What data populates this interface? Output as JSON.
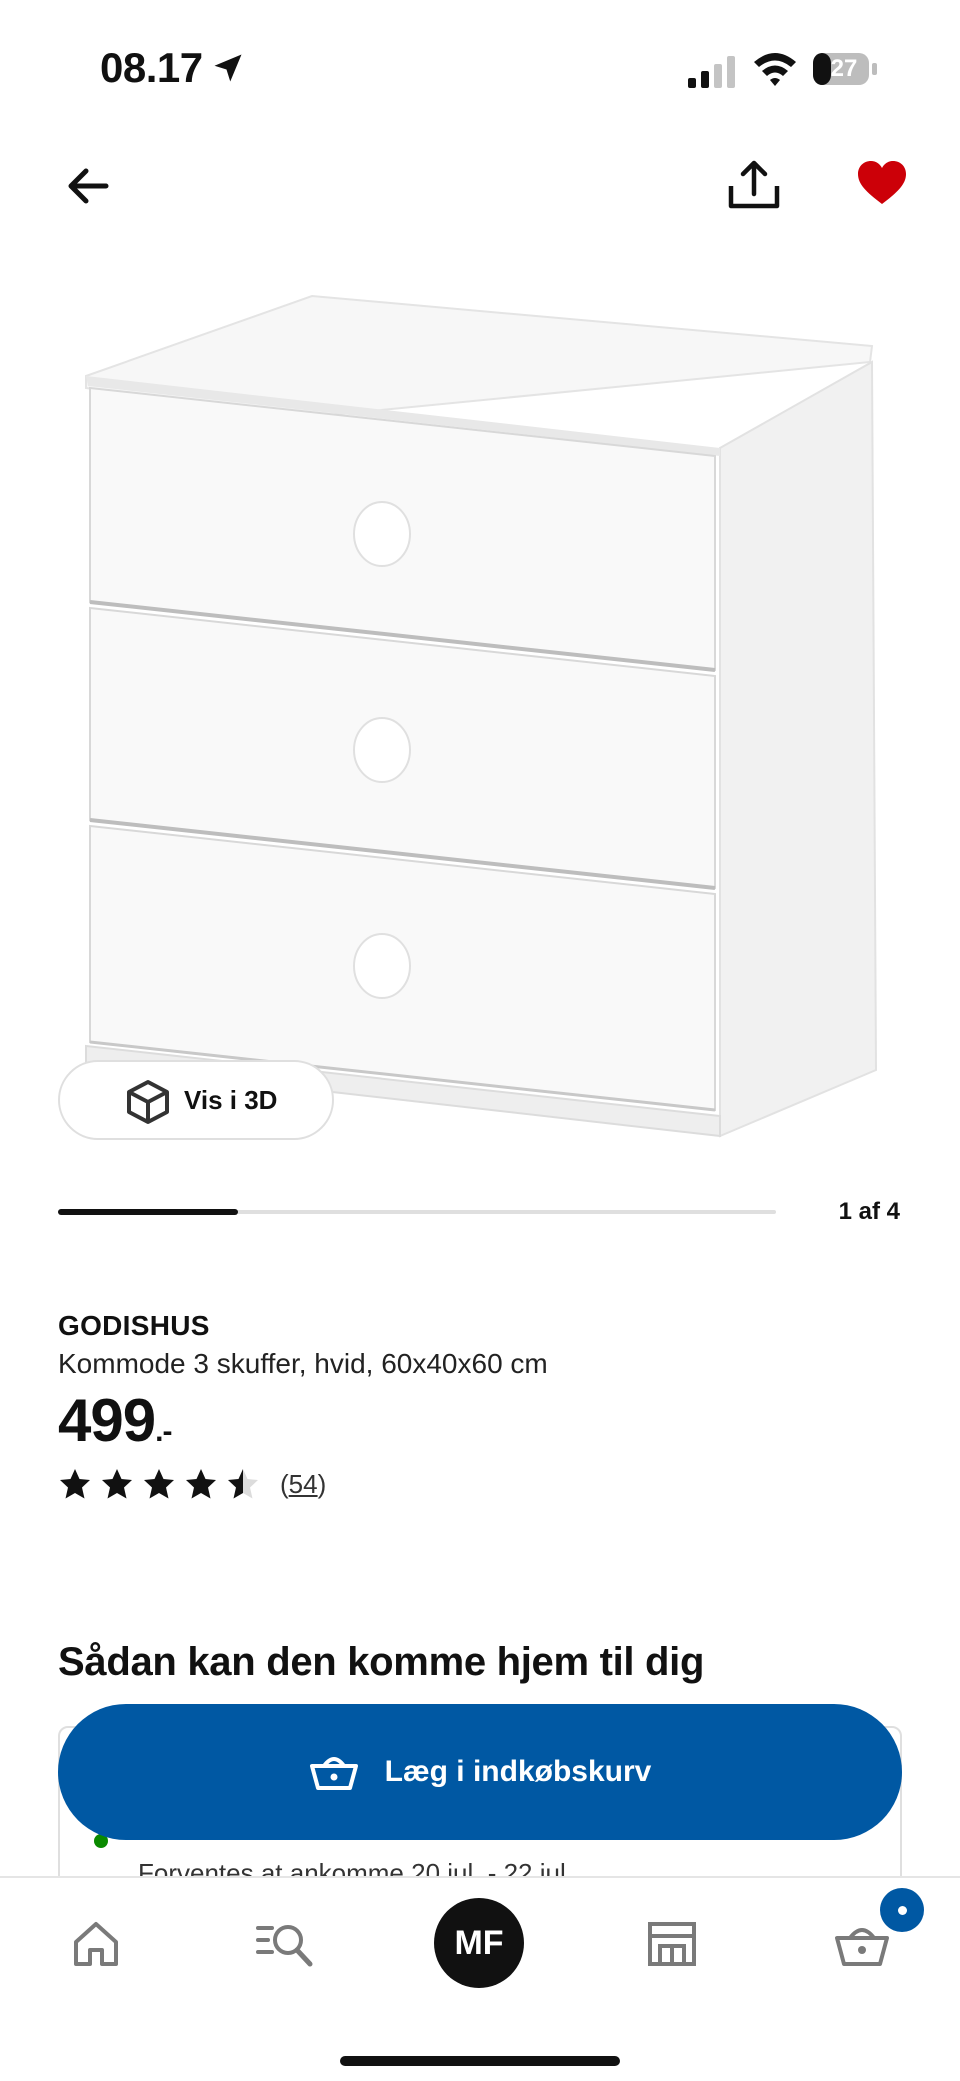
{
  "status_bar": {
    "time": "08.17",
    "battery": "27"
  },
  "header": {
    "back": "back",
    "share": "share",
    "favourite": "favourite"
  },
  "gallery": {
    "view_3d_label": "Vis i 3D",
    "page_count": "1 af 4",
    "progress": 0.25
  },
  "product": {
    "brand": "GODISHUS",
    "description": "Kommode 3 skuffer, hvid, 60x40x60 cm",
    "price": "499",
    "price_suffix": ".-",
    "rating": 4.5,
    "review_count": "54"
  },
  "delivery": {
    "heading": "Sådan kan den komme hjem til dig",
    "estimate": "Forventes at ankomme 20 jul. - 22 jul."
  },
  "cart_button": {
    "label": "Læg i indkøbskurv"
  },
  "bottom_nav": {
    "profile_initials": "MF"
  },
  "colors": {
    "brand_blue": "#0058a3",
    "favourite_red": "#cc0008",
    "in_stock_green": "#0a8a00"
  }
}
